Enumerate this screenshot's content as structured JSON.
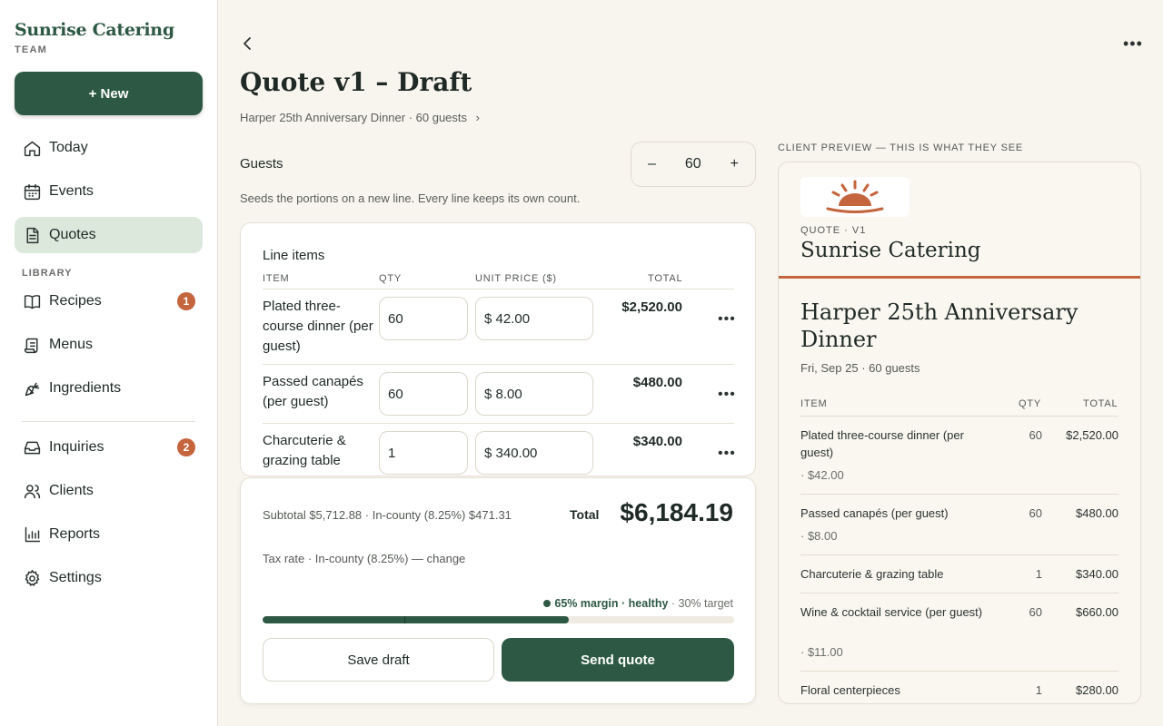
{
  "brand": {
    "name": "Sunrise Catering",
    "sub": "TEAM"
  },
  "new_button": "+ New",
  "nav": [
    {
      "label": "Today",
      "icon": "home-icon"
    },
    {
      "label": "Events",
      "icon": "calendar-icon"
    },
    {
      "label": "Quotes",
      "icon": "document-icon",
      "active": true
    }
  ],
  "library_label": "LIBRARY",
  "library": [
    {
      "label": "Recipes",
      "icon": "book-icon",
      "badge": "1"
    },
    {
      "label": "Menus",
      "icon": "scroll-icon"
    },
    {
      "label": "Ingredients",
      "icon": "carrot-icon"
    }
  ],
  "nav2": [
    {
      "label": "Inquiries",
      "icon": "inbox-icon",
      "badge": "2"
    },
    {
      "label": "Clients",
      "icon": "users-icon"
    },
    {
      "label": "Reports",
      "icon": "chart-icon"
    },
    {
      "label": "Settings",
      "icon": "gear-icon"
    }
  ],
  "header": {
    "title": "Quote v1 – Draft",
    "subtitle": "Harper 25th Anniversary Dinner · 60 guests"
  },
  "guests": {
    "label": "Guests",
    "minus": "–",
    "plus": "+",
    "value": "60",
    "hint": "Seeds the portions on a new line. Every line keeps its own count."
  },
  "line_items": {
    "title": "Line items",
    "columns": {
      "item": "ITEM",
      "qty": "QTY",
      "unit": "UNIT PRICE ($)",
      "total": "TOTAL"
    },
    "rows": [
      {
        "name": "Plated three-course dinner (per guest)",
        "qty": "60",
        "unit": "$ 42.00",
        "total": "$2,520.00"
      },
      {
        "name": "Passed canapés (per guest)",
        "qty": "60",
        "unit": "$ 8.00",
        "total": "$480.00"
      },
      {
        "name": "Charcuterie & grazing table",
        "qty": "1",
        "unit": "$ 340.00",
        "total": "$340.00"
      }
    ]
  },
  "totals": {
    "subtotal_line": "Subtotal $5,712.88 · In-county (8.25%) $471.31",
    "total_label": "Total",
    "total_value": "$6,184.19",
    "tax_line": "Tax rate · In-county (8.25%) — change",
    "margin_text": "65% margin · healthy",
    "target_text": " · 30% target",
    "margin_fraction": 0.65,
    "target_fraction": 0.3,
    "save_label": "Save draft",
    "send_label": "Send quote"
  },
  "preview": {
    "label": "CLIENT PREVIEW — THIS IS WHAT THEY SEE",
    "quote_label": "QUOTE · V1",
    "brand": "Sunrise Catering",
    "event": "Harper 25th Anniversary Dinner",
    "date": "Fri, Sep 25 · 60 guests",
    "columns": {
      "item": "ITEM",
      "qty": "QTY",
      "total": "TOTAL"
    },
    "rows": [
      {
        "name": "Plated three-course dinner (per guest)",
        "unit": "· $42.00",
        "qty": "60",
        "total": "$2,520.00"
      },
      {
        "name": "Passed canapés (per guest)",
        "unit": "· $8.00",
        "qty": "60",
        "total": "$480.00"
      },
      {
        "name": "Charcuterie & grazing table",
        "unit": "",
        "qty": "1",
        "total": "$340.00"
      },
      {
        "name": "Wine & cocktail service (per guest)",
        "unit": "· $11.00",
        "qty": "60",
        "total": "$660.00"
      },
      {
        "name": "Floral centerpieces",
        "unit": "",
        "qty": "1",
        "total": "$280.00"
      }
    ]
  },
  "colors": {
    "brand_green": "#2d5944",
    "accent": "#c4653e",
    "background": "#f8f5ee"
  }
}
